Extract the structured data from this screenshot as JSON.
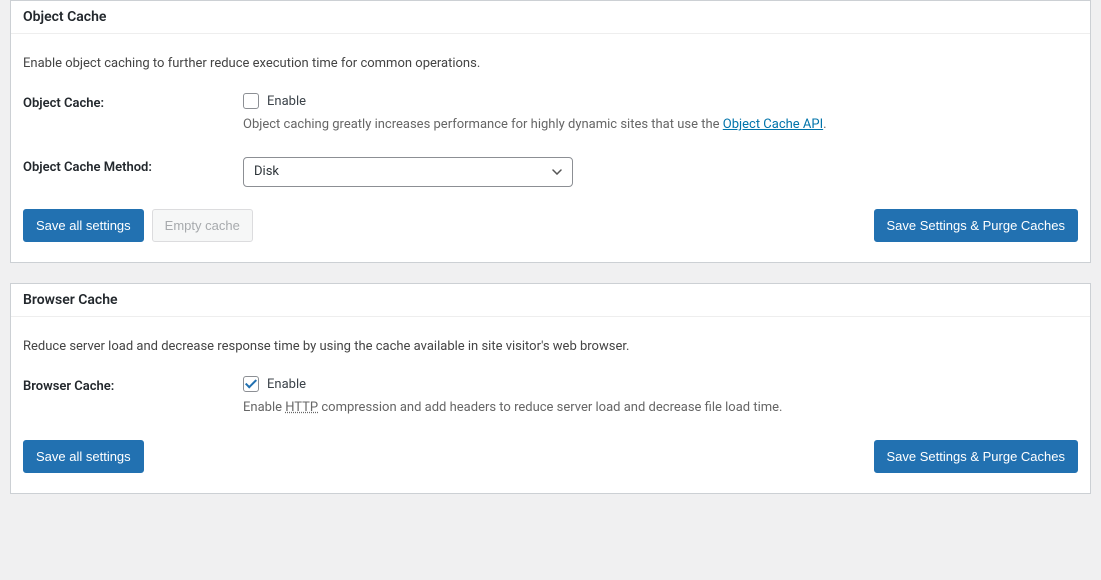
{
  "sections": {
    "object_cache": {
      "title": "Object Cache",
      "description": "Enable object caching to further reduce execution time for common operations.",
      "fields": {
        "enable": {
          "label": "Object Cache:",
          "checkbox_label": "Enable",
          "checked": false,
          "hint_prefix": "Object caching greatly increases performance for highly dynamic sites that use the ",
          "hint_link": "Object Cache API",
          "hint_suffix": "."
        },
        "method": {
          "label": "Object Cache Method:",
          "value": "Disk"
        }
      },
      "buttons": {
        "save": "Save all settings",
        "empty": "Empty cache",
        "purge": "Save Settings & Purge Caches"
      }
    },
    "browser_cache": {
      "title": "Browser Cache",
      "description": "Reduce server load and decrease response time by using the cache available in site visitor's web browser.",
      "fields": {
        "enable": {
          "label": "Browser Cache:",
          "checkbox_label": "Enable",
          "checked": true,
          "hint_prefix": "Enable ",
          "hint_abbr": "HTTP",
          "hint_suffix": " compression and add headers to reduce server load and decrease file load time."
        }
      },
      "buttons": {
        "save": "Save all settings",
        "purge": "Save Settings & Purge Caches"
      }
    }
  }
}
